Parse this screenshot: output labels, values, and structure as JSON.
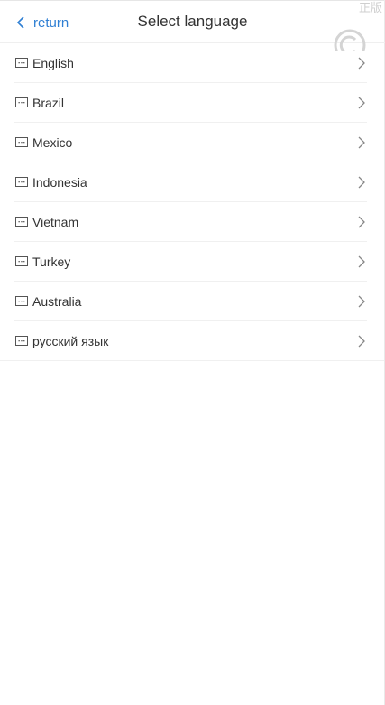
{
  "header": {
    "back_label": "return",
    "title": "Select language",
    "watermark_text": "正版"
  },
  "languages": [
    {
      "label": "English"
    },
    {
      "label": "Brazil"
    },
    {
      "label": "Mexico"
    },
    {
      "label": "Indonesia"
    },
    {
      "label": "Vietnam"
    },
    {
      "label": "Turkey"
    },
    {
      "label": "Australia"
    },
    {
      "label": "русский язык"
    }
  ],
  "icons": {
    "back": "chevron-left-icon",
    "item": "message-box-icon",
    "row_arrow": "chevron-right-icon",
    "watermark": "copyright-icon"
  },
  "colors": {
    "accent": "#2f7fd3",
    "text": "#333333",
    "divider": "#f0f0f0"
  }
}
